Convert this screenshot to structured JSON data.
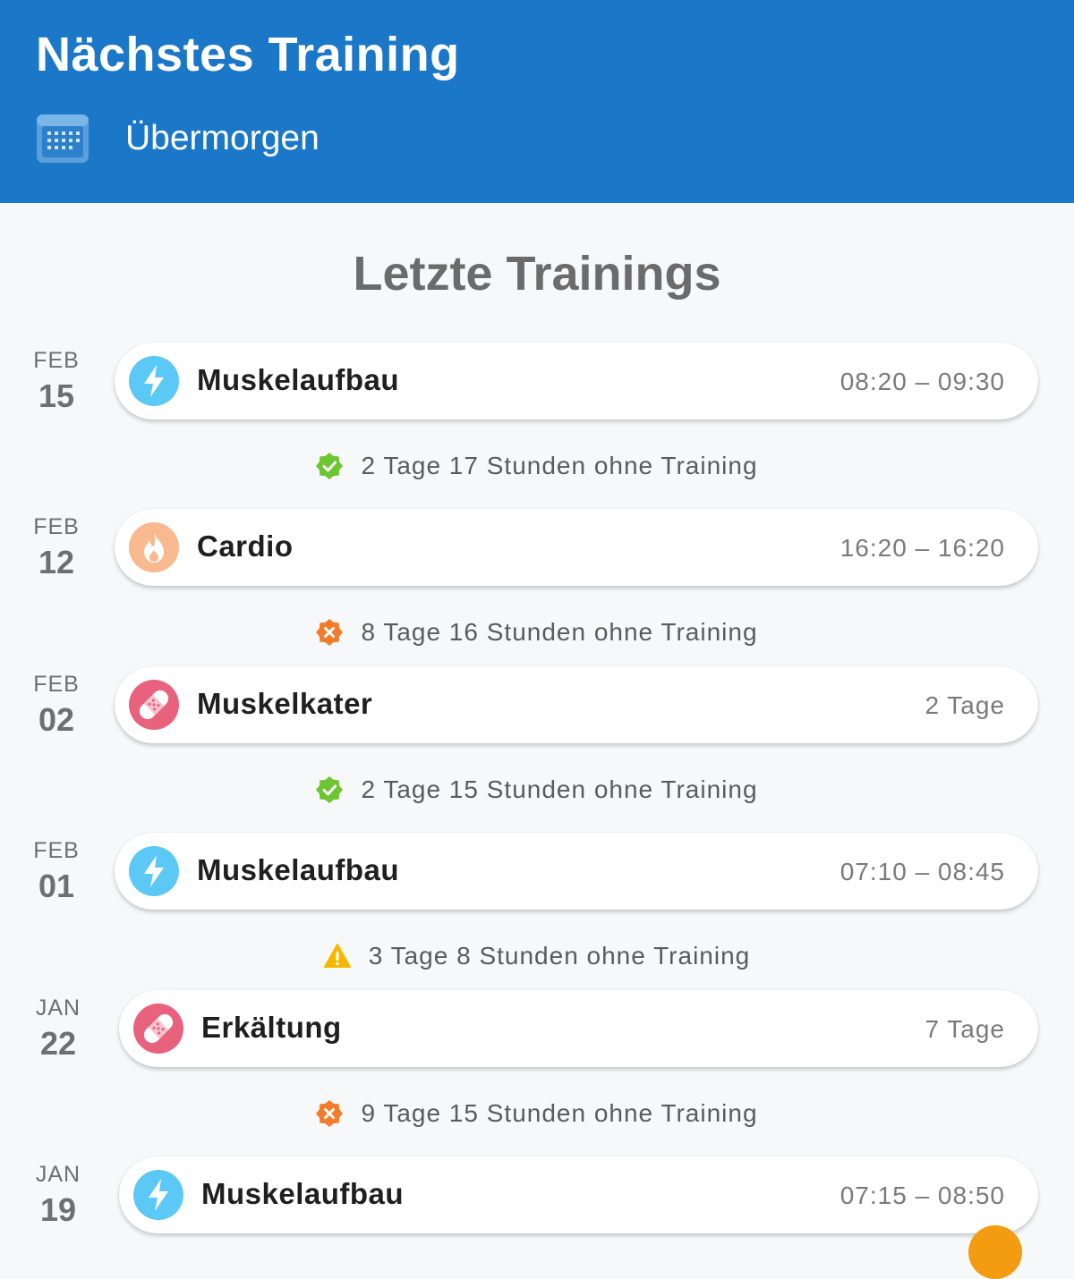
{
  "header": {
    "title": "Nächstes Training",
    "subtitle": "Übermorgen",
    "icon": "calendar-icon",
    "background": "#1b77c7"
  },
  "section_title": "Letzte Trainings",
  "entries": [
    {
      "month": "FEB",
      "day": "15",
      "type": "Muskelaufbau",
      "icon": "lightning-icon",
      "meta": "08:20 – 09:30"
    },
    {
      "month": "FEB",
      "day": "12",
      "type": "Cardio",
      "icon": "flame-icon",
      "meta": "16:20 – 16:20"
    },
    {
      "month": "FEB",
      "day": "02",
      "type": "Muskelkater",
      "icon": "bandage-icon",
      "meta": "2 Tage"
    },
    {
      "month": "FEB",
      "day": "01",
      "type": "Muskelaufbau",
      "icon": "lightning-icon",
      "meta": "07:10 – 08:45"
    },
    {
      "month": "JAN",
      "day": "22",
      "type": "Erkältung",
      "icon": "bandage-icon",
      "meta": "7 Tage"
    },
    {
      "month": "JAN",
      "day": "19",
      "type": "Muskelaufbau",
      "icon": "lightning-icon",
      "meta": "07:15 – 08:50"
    }
  ],
  "gaps": [
    {
      "text": "2 Tage 17 Stunden ohne Training",
      "status": "ok",
      "icon": "check-badge-icon"
    },
    {
      "text": "8 Tage 16 Stunden ohne Training",
      "status": "bad",
      "icon": "cross-badge-icon"
    },
    {
      "text": "2 Tage 15 Stunden ohne Training",
      "status": "ok",
      "icon": "check-badge-icon"
    },
    {
      "text": "3 Tage 8 Stunden ohne Training",
      "status": "warn",
      "icon": "warning-icon"
    },
    {
      "text": "9 Tage 15 Stunden ohne Training",
      "status": "bad",
      "icon": "cross-badge-icon"
    }
  ],
  "colors": {
    "lightning": "#5bc8f5",
    "flame": "#f9b98f",
    "bandage": "#e8627d",
    "ok": "#6cc531",
    "bad": "#f37b29",
    "warn": "#f5b800",
    "fab": "#f39c12"
  }
}
